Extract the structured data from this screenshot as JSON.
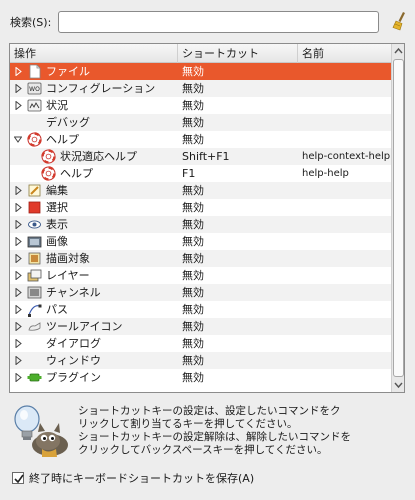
{
  "search": {
    "label": "検索(S):",
    "value": "",
    "placeholder": ""
  },
  "columns": {
    "action": "操作",
    "shortcut": "ショートカット",
    "name": "名前"
  },
  "rows": [
    {
      "label": "ファイル",
      "shortcut": "無効",
      "name": "",
      "icon": "file-icon",
      "expander": "collapsed",
      "selected": true
    },
    {
      "label": "コンフィグレーション",
      "shortcut": "無効",
      "name": "",
      "icon": "config-icon",
      "expander": "collapsed"
    },
    {
      "label": "状況",
      "shortcut": "無効",
      "name": "",
      "icon": "status-icon",
      "expander": "collapsed"
    },
    {
      "label": "デバッグ",
      "shortcut": "無効",
      "name": "",
      "icon": "",
      "expander": "none"
    },
    {
      "label": "ヘルプ",
      "shortcut": "無効",
      "name": "",
      "icon": "help-icon",
      "expander": "expanded"
    },
    {
      "label": "状況適応ヘルプ",
      "shortcut": "Shift+F1",
      "name": "help-context-help",
      "icon": "help-icon",
      "expander": "none",
      "child": true
    },
    {
      "label": "ヘルプ",
      "shortcut": "F1",
      "name": "help-help",
      "icon": "help-icon",
      "expander": "none",
      "child": true
    },
    {
      "label": "編集",
      "shortcut": "無効",
      "name": "",
      "icon": "edit-icon",
      "expander": "collapsed"
    },
    {
      "label": "選択",
      "shortcut": "無効",
      "name": "",
      "icon": "select-icon",
      "expander": "collapsed"
    },
    {
      "label": "表示",
      "shortcut": "無効",
      "name": "",
      "icon": "view-icon",
      "expander": "collapsed"
    },
    {
      "label": "画像",
      "shortcut": "無効",
      "name": "",
      "icon": "image-icon",
      "expander": "collapsed"
    },
    {
      "label": "描画対象",
      "shortcut": "無効",
      "name": "",
      "icon": "drawable-icon",
      "expander": "collapsed"
    },
    {
      "label": "レイヤー",
      "shortcut": "無効",
      "name": "",
      "icon": "layer-icon",
      "expander": "collapsed"
    },
    {
      "label": "チャンネル",
      "shortcut": "無効",
      "name": "",
      "icon": "channel-icon",
      "expander": "collapsed"
    },
    {
      "label": "パス",
      "shortcut": "無効",
      "name": "",
      "icon": "path-icon",
      "expander": "collapsed"
    },
    {
      "label": "ツールアイコン",
      "shortcut": "無効",
      "name": "",
      "icon": "tool-icon",
      "expander": "collapsed"
    },
    {
      "label": "ダイアログ",
      "shortcut": "無効",
      "name": "",
      "icon": "",
      "expander": "collapsed"
    },
    {
      "label": "ウィンドウ",
      "shortcut": "無効",
      "name": "",
      "icon": "",
      "expander": "collapsed"
    },
    {
      "label": "プラグイン",
      "shortcut": "無効",
      "name": "",
      "icon": "plugin-icon",
      "expander": "collapsed"
    }
  ],
  "hint": {
    "line1": "ショートカットキーの設定は、設定したいコマンドをク",
    "line2": "リックして割り当てるキーを押してください。",
    "line3": "ショートカットキーの設定解除は、解除したいコマンドを",
    "line4": "クリックしてバックスペースキーを押してください。"
  },
  "save_on_exit": {
    "label": "終了時にキーボードショートカットを保存(A)",
    "checked": true
  },
  "colors": {
    "selection": "#e9582c",
    "accent_red": "#d33a2c"
  }
}
